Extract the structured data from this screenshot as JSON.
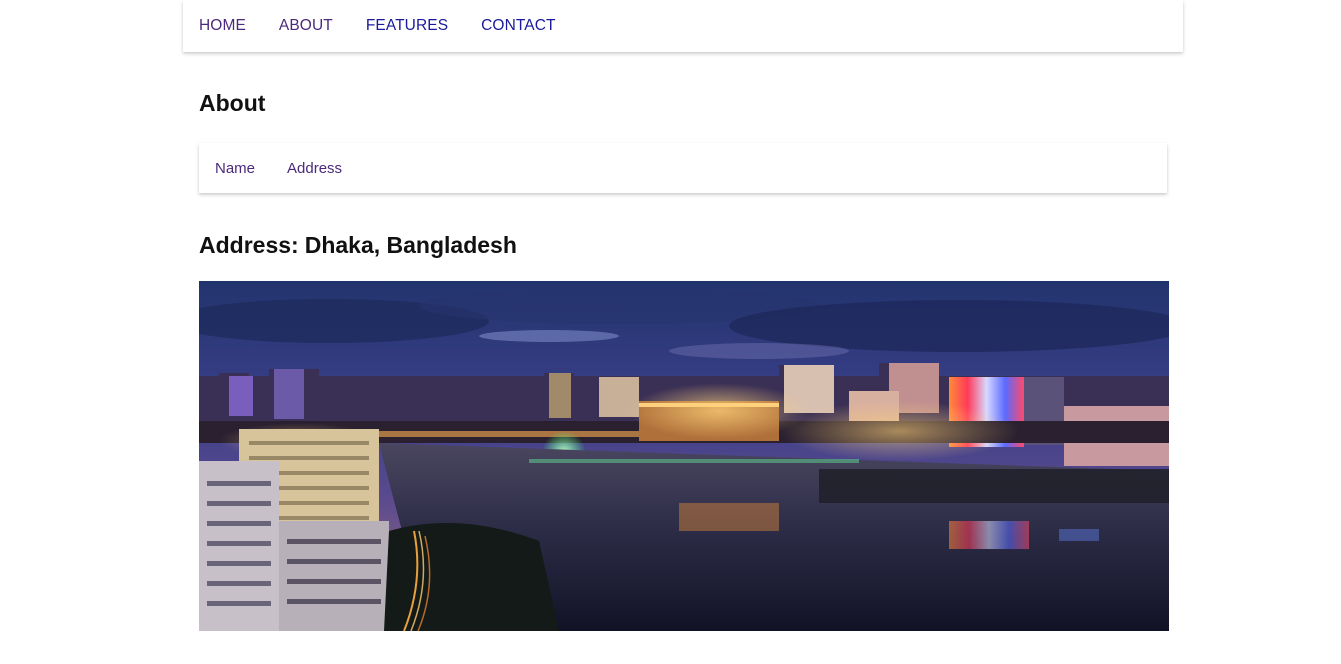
{
  "nav": {
    "items": [
      {
        "label": "HOME"
      },
      {
        "label": "ABOUT"
      },
      {
        "label": "FEATURES"
      },
      {
        "label": "CONTACT"
      }
    ]
  },
  "about": {
    "title": "About",
    "tabs": [
      {
        "label": "Name"
      },
      {
        "label": "Address"
      }
    ]
  },
  "address": {
    "prefix": "Address:",
    "value": "Dhaka, Bangladesh"
  },
  "photo": {
    "subject": "Dhaka skyline at night"
  },
  "colors": {
    "link_visited": "#4a2a7c",
    "link": "#1a1a9a",
    "heading": "#111111"
  }
}
